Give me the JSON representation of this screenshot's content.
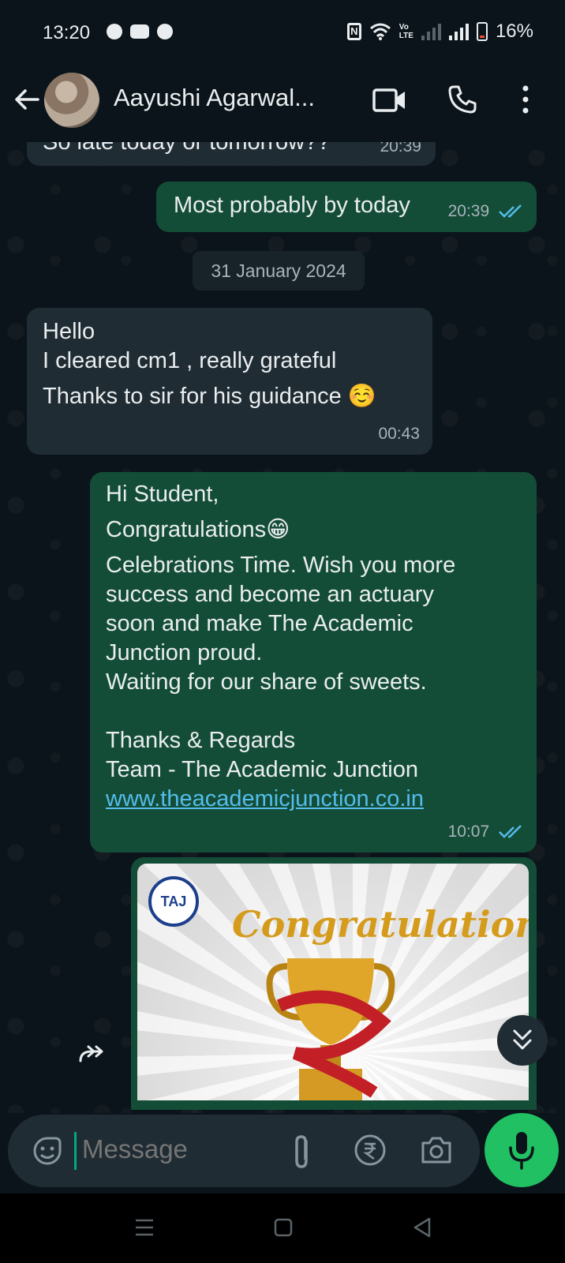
{
  "status_bar": {
    "time": "13:20",
    "battery": "16%",
    "volte": "Vo\nLTE"
  },
  "header": {
    "contact_name": "Aayushi Agarwal..."
  },
  "messages": [
    {
      "type": "in",
      "text": "So late today or tomorrow??",
      "time": "20:39"
    },
    {
      "type": "out",
      "text": "Most probably by today",
      "time": "20:39"
    },
    {
      "type": "in",
      "lines": [
        "Hello",
        "I cleared cm1 , really grateful",
        "Thanks to sir for his guidance ☺️"
      ],
      "time": "00:43"
    },
    {
      "type": "out",
      "lines": [
        "Hi Student,",
        "Congratulations😁",
        "Celebrations Time. Wish you more",
        "success and become an actuary",
        "soon and make The Academic",
        "Junction proud.",
        "Waiting for our share of sweets.",
        "",
        "Thanks & Regards",
        "Team - The Academic Junction"
      ],
      "link": "www.theacademicjunction.co.in",
      "time": "10:07"
    }
  ],
  "date_separator": "31 January 2024",
  "image_message": {
    "logo_text": "TAJ",
    "title": "Congratulations"
  },
  "composer": {
    "placeholder": "Message"
  },
  "colors": {
    "outgoing": "#144d37",
    "incoming": "#202c33",
    "accent": "#21c063",
    "read_ticks": "#53bdeb"
  },
  "icons": [
    "back-arrow-icon",
    "video-call-icon",
    "phone-icon",
    "more-vertical-icon",
    "sticker-icon",
    "attach-icon",
    "rupee-icon",
    "camera-icon",
    "mic-icon",
    "forward-icon",
    "scroll-down-icon"
  ]
}
